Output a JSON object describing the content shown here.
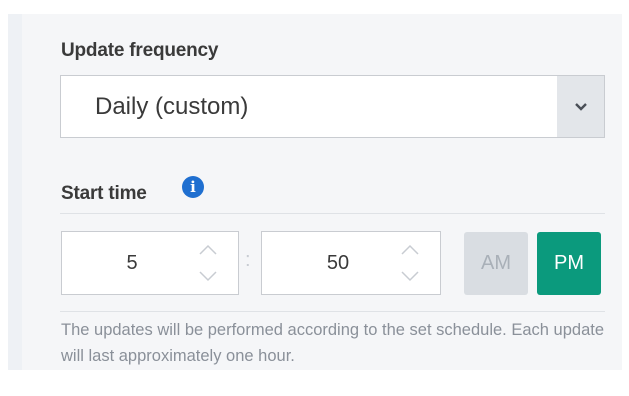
{
  "update_frequency": {
    "label": "Update frequency",
    "selected_value": "Daily (custom)"
  },
  "start_time": {
    "label": "Start time",
    "hours": "5",
    "minutes": "50",
    "separator": ":",
    "am_label": "AM",
    "pm_label": "PM",
    "selected_period": "PM"
  },
  "help_text": "The updates will be performed according to the set schedule. Each update will last approximately one hour.",
  "colors": {
    "accent": "#0b9a7d",
    "info_icon": "#1f6fd0",
    "panel_bg": "#f5f6f8"
  },
  "icons": {
    "info": "info-icon",
    "dropdown": "chevron-down-icon",
    "increment": "chevron-up-icon",
    "decrement": "chevron-down-icon"
  }
}
